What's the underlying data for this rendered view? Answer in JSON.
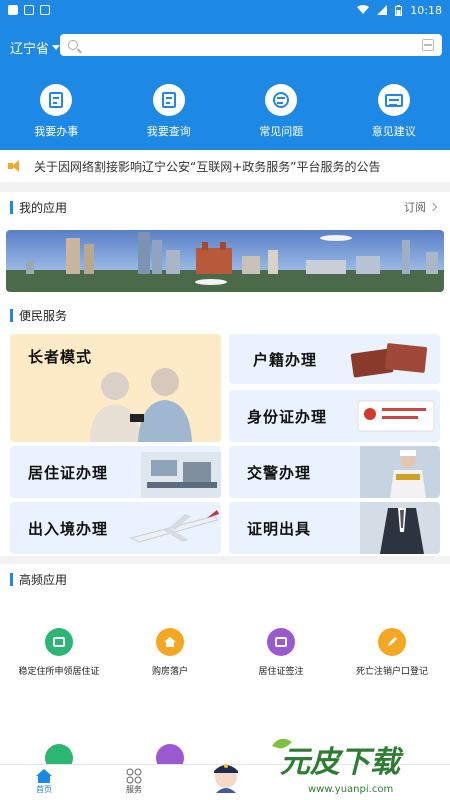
{
  "status_bar": {
    "time": "10:18"
  },
  "header": {
    "region": "辽宁省",
    "search_placeholder": ""
  },
  "quick_actions": [
    {
      "label": "我要办事",
      "icon": "document-icon"
    },
    {
      "label": "我要查询",
      "icon": "search-doc-icon"
    },
    {
      "label": "常见问题",
      "icon": "chat-icon"
    },
    {
      "label": "意见建议",
      "icon": "mail-icon"
    }
  ],
  "notice": {
    "text": "关于因网络割接影响辽宁公安“互联网+政务服务”平台服务的公告"
  },
  "my_apps": {
    "title": "我的应用",
    "more": "订阅"
  },
  "services": {
    "title": "便民服务",
    "tiles": [
      "长者模式",
      "户籍办理",
      "身份证办理",
      "居住证办理",
      "交警办理",
      "出入境办理",
      "证明出具"
    ]
  },
  "high_freq": {
    "title": "高频应用",
    "items": [
      {
        "label": "稳定住所申领居住证",
        "color": "#2bb673"
      },
      {
        "label": "购房落户",
        "color": "#f5a623"
      },
      {
        "label": "居住证签注",
        "color": "#9b59d0"
      },
      {
        "label": "死亡注销户口登记",
        "color": "#f5a623"
      }
    ],
    "row2_colors": [
      "#2bb673",
      "#9b59d0"
    ]
  },
  "bottom_nav": [
    {
      "label": "首页",
      "active": true
    },
    {
      "label": "服务",
      "active": false
    }
  ],
  "watermark": {
    "text": "元皮下载",
    "url": "www.yuanpi.com"
  },
  "colors": {
    "primary": "#1e88e5",
    "accent": "#f5a623"
  }
}
